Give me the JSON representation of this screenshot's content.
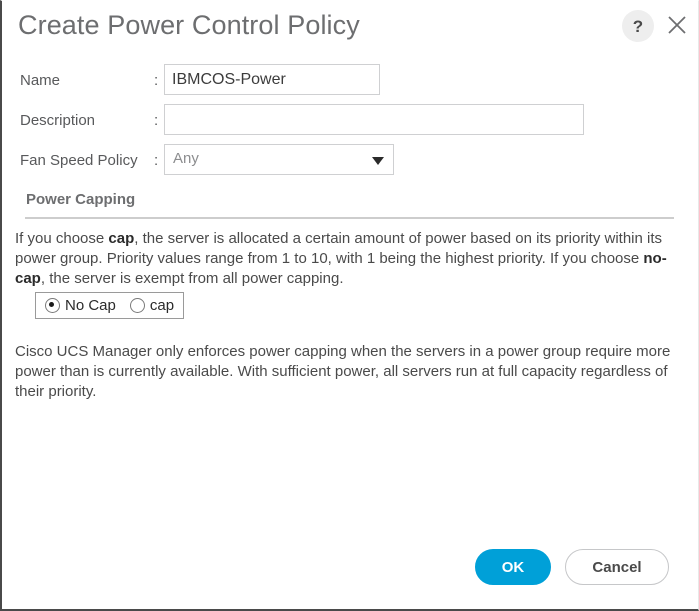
{
  "dialog": {
    "title": "Create Power Control Policy",
    "help_icon": "question-mark-icon",
    "close_icon": "close-icon",
    "accent_color": "#00a0d8"
  },
  "form": {
    "rows": [
      {
        "label": "Name",
        "colon": ":",
        "value": "IBMCOS-Power",
        "placeholder": ""
      },
      {
        "label": "Description",
        "colon": ":",
        "value": "",
        "placeholder": ""
      },
      {
        "label": "Fan Speed Policy",
        "colon": ":",
        "value": "Any",
        "placeholder": ""
      }
    ]
  },
  "section": {
    "title": "Power Capping",
    "paragraph1_part1": "If you choose ",
    "paragraph1_bold1": "cap",
    "paragraph1_part2": ", the server is allocated a certain amount of power based on its priority within its power group. Priority values range from 1 to 10, with 1 being the highest priority. If you choose ",
    "paragraph1_bold2": "no-cap",
    "paragraph1_part3": ", the server is exempt from all power capping.",
    "paragraph2": "Cisco UCS Manager only enforces power capping when the servers in a power group require more power than is currently available. With sufficient power, all servers run at full capacity regardless of their priority."
  },
  "power_capping": {
    "options": [
      {
        "label": "No Cap",
        "selected": true
      },
      {
        "label": "cap",
        "selected": false
      }
    ]
  },
  "footer": {
    "ok_label": "OK",
    "cancel_label": "Cancel"
  }
}
